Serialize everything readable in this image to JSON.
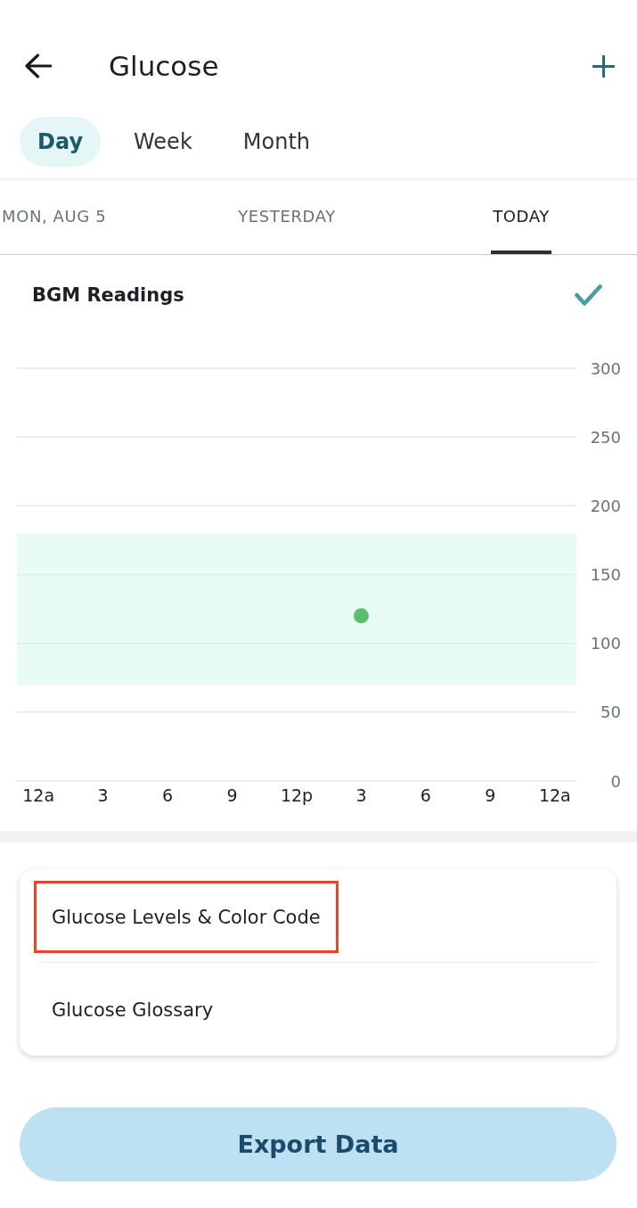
{
  "header": {
    "title": "Glucose"
  },
  "period_tabs": [
    {
      "label": "Day",
      "selected": true
    },
    {
      "label": "Week",
      "selected": false
    },
    {
      "label": "Month",
      "selected": false
    }
  ],
  "date_tabs": [
    {
      "label": "MON, AUG 5",
      "selected": false
    },
    {
      "label": "YESTERDAY",
      "selected": false
    },
    {
      "label": "TODAY",
      "selected": true
    }
  ],
  "readings": {
    "title": "BGM Readings",
    "chart_data": {
      "type": "scatter",
      "categories": [
        "12a",
        "3",
        "6",
        "9",
        "12p",
        "3",
        "6",
        "9",
        "12a"
      ],
      "series": [
        {
          "color": "#5cbf6c",
          "values": [
            null,
            null,
            null,
            null,
            null,
            120,
            null,
            null,
            null
          ]
        }
      ],
      "ylim": [
        0,
        300
      ],
      "yticks": [
        0,
        50,
        100,
        150,
        200,
        250,
        300
      ],
      "grid": true,
      "bands": [
        {
          "axis": "y",
          "from": 70,
          "to": 180
        }
      ]
    }
  },
  "links": [
    {
      "label": "Glucose Levels & Color Code",
      "highlighted": true
    },
    {
      "label": "Glucose Glossary",
      "highlighted": false
    }
  ],
  "export_button": {
    "label": "Export Data"
  }
}
